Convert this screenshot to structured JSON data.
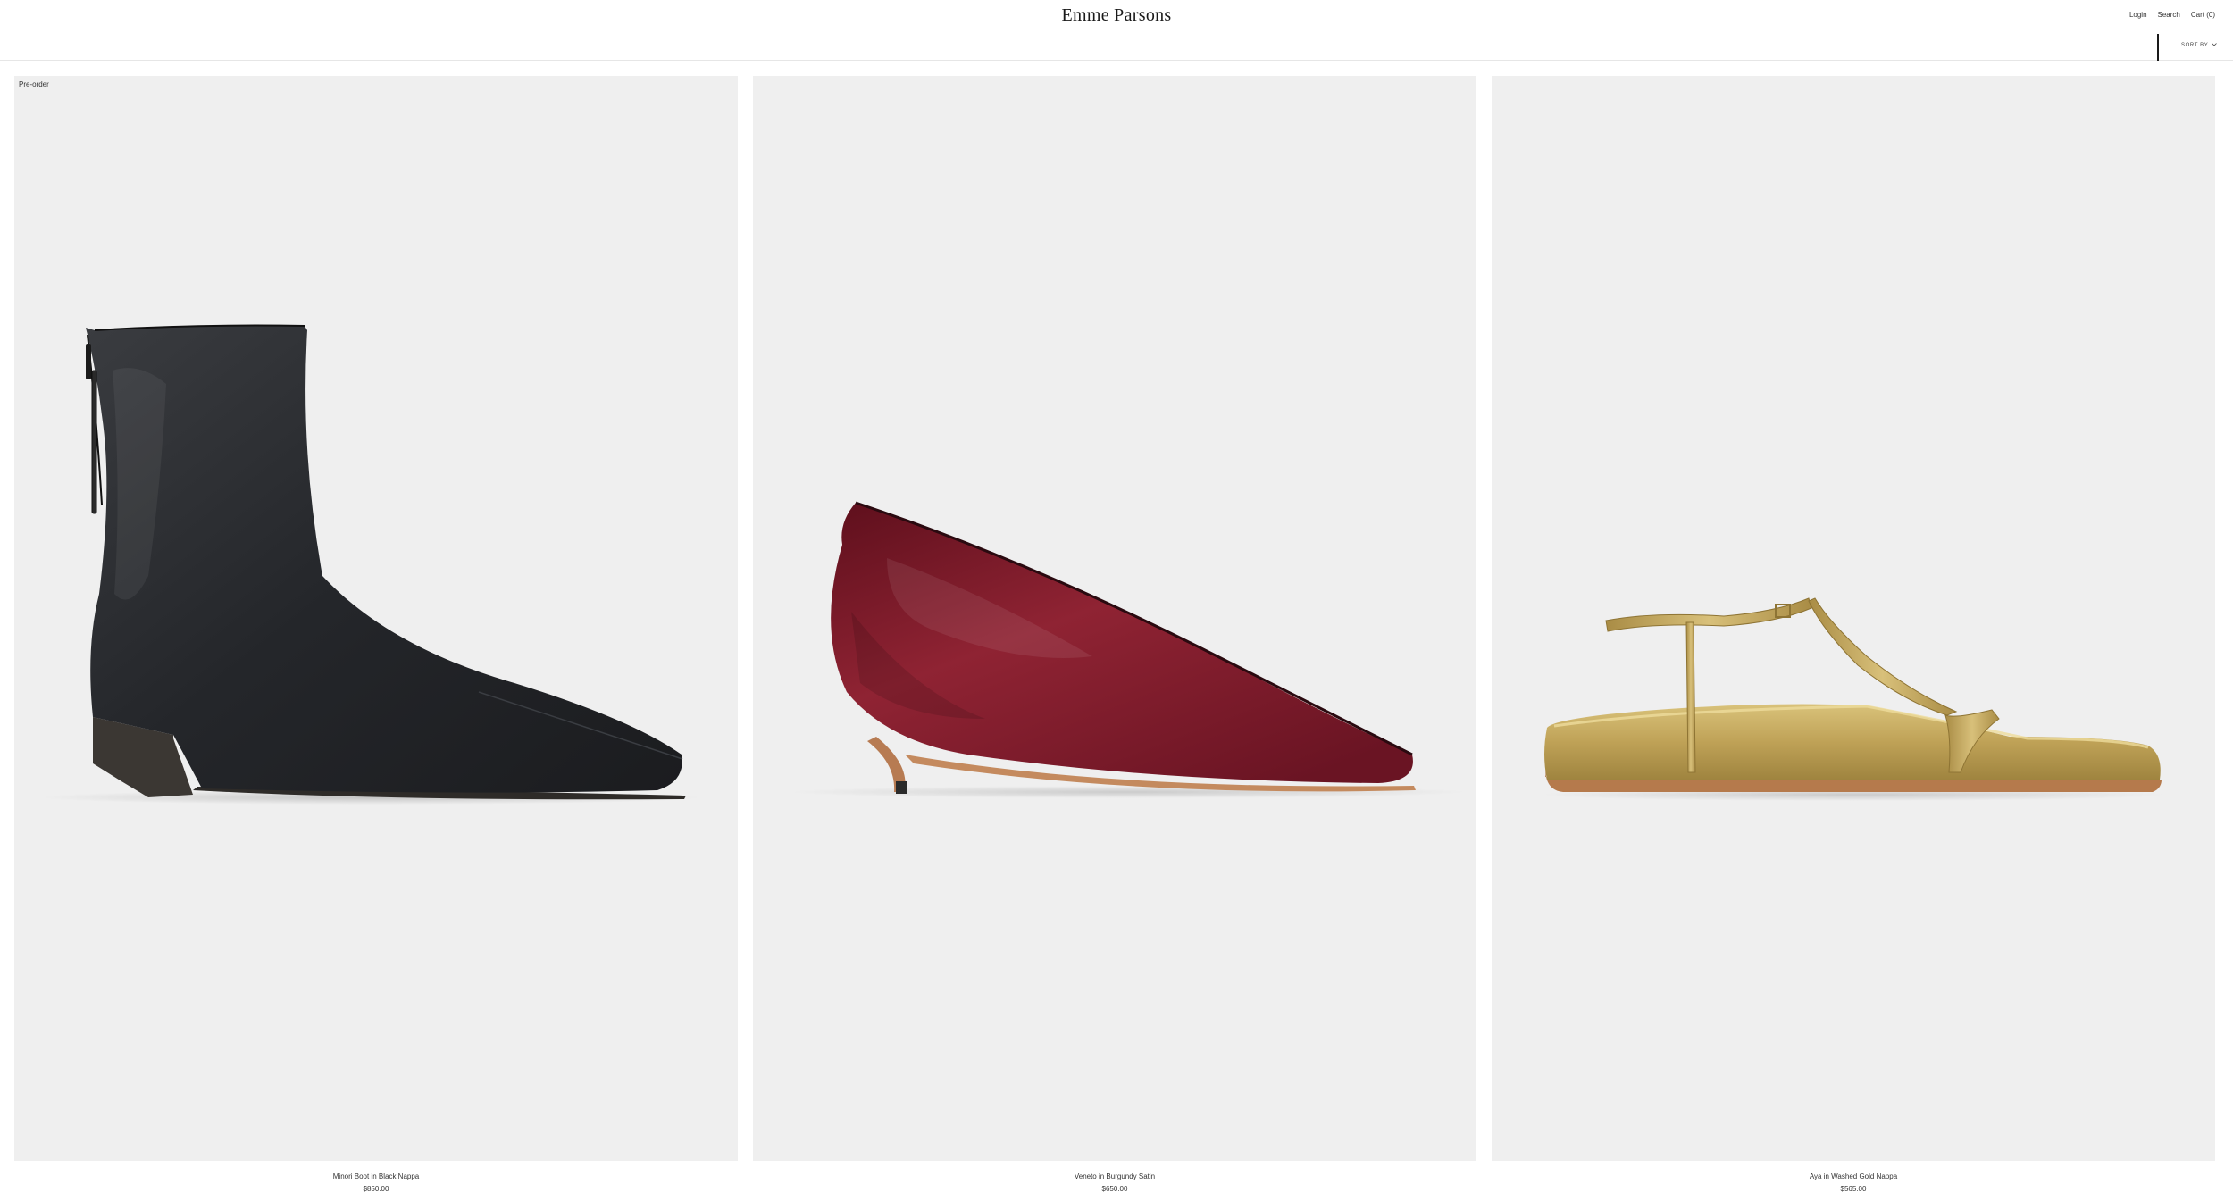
{
  "header": {
    "brand": "Emme Parsons",
    "nav": {
      "login": "Login",
      "search": "Search",
      "cart": "Cart (0)"
    }
  },
  "toolbar": {
    "sort_label": "SORT BY"
  },
  "products": [
    {
      "badge": "Pre-order",
      "name": "Minori Boot in Black Nappa",
      "price": "$850.00",
      "color": "#2a2b2d"
    },
    {
      "name": "Veneto in Burgundy Satin",
      "price": "$650.00",
      "color": "#8a1f2d"
    },
    {
      "name": "Aya in Washed Gold Nappa",
      "price": "$565.00",
      "color": "#c9ad5e"
    }
  ],
  "colors": {
    "background": "#ffffff",
    "image_bg": "#efefef",
    "text": "#333333"
  }
}
